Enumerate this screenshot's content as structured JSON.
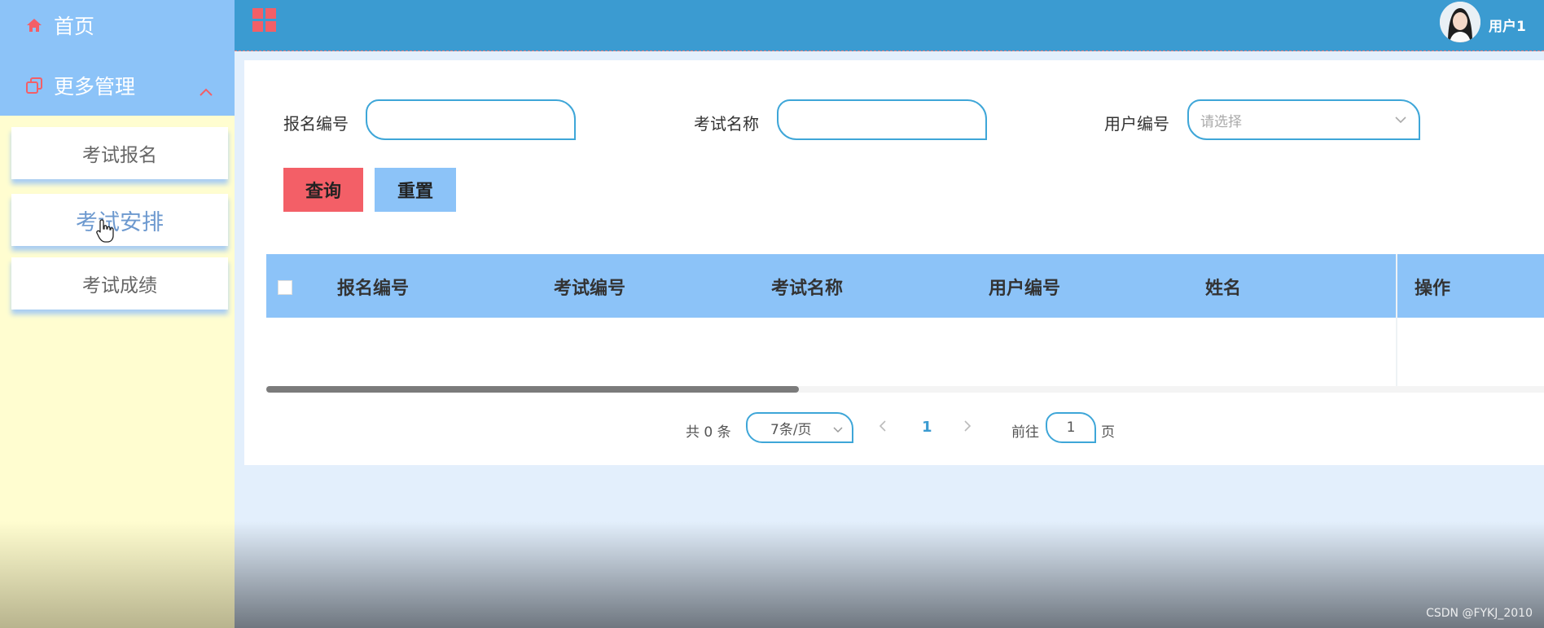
{
  "sidebar": {
    "home_label": "首页",
    "more_label": "更多管理",
    "sub_items": [
      {
        "label": "考试报名"
      },
      {
        "label": "考试安排"
      },
      {
        "label": "考试成绩"
      }
    ]
  },
  "header": {
    "user_name": "用户1"
  },
  "search": {
    "field1_label": "报名编号",
    "field1_value": "",
    "field2_label": "考试名称",
    "field2_value": "",
    "field3_label": "用户编号",
    "field3_placeholder": "请选择",
    "query_label": "查询",
    "reset_label": "重置"
  },
  "table": {
    "columns": [
      "报名编号",
      "考试编号",
      "考试名称",
      "用户编号",
      "姓名",
      "操作"
    ],
    "rows": []
  },
  "pagination": {
    "total_text": "共 0 条",
    "page_size": "7条/页",
    "current_page": "1",
    "goto_label": "前往",
    "goto_value": "1",
    "page_suffix": "页"
  },
  "watermark": "CSDN @FYKJ_2010",
  "colors": {
    "header": "#3b9bd1",
    "sidebar_top": "#8cc3f8",
    "query_button": "#f35f67",
    "accent": "#8cc3f8"
  }
}
